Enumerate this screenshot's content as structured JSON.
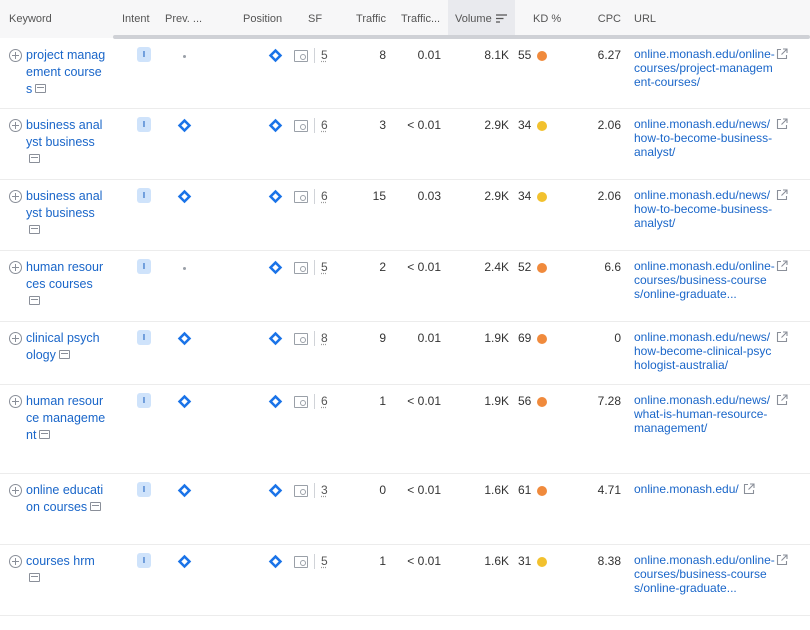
{
  "header": {
    "keyword": "Keyword",
    "intent": "Intent",
    "prev": "Prev. ...",
    "position": "Position",
    "sf": "SF",
    "traffic": "Traffic",
    "traffic_share": "Traffic...",
    "volume": "Volume",
    "kd": "KD %",
    "cpc": "CPC",
    "url": "URL"
  },
  "colors": {
    "link": "#1a66c9",
    "kd_orange": "#f08a3c",
    "kd_yellow": "#f2c12e",
    "intent_bg": "#cfe3fb",
    "diamond": "#1a73e8"
  },
  "rows": [
    {
      "keyword": "project management courses",
      "intent": "I",
      "prev": "dot",
      "sf": "5",
      "traffic": "8",
      "traffic_share": "0.01",
      "volume": "8.1K",
      "kd": "55",
      "kd_color": "orange",
      "cpc": "6.27",
      "url": "online.monash.edu/online-courses/project-management-courses/"
    },
    {
      "keyword": "business analyst business",
      "intent": "I",
      "prev": "diamond",
      "sf": "6",
      "traffic": "3",
      "traffic_share": "< 0.01",
      "volume": "2.9K",
      "kd": "34",
      "kd_color": "yellow",
      "cpc": "2.06",
      "url": "online.monash.edu/news/how-to-become-business-analyst/"
    },
    {
      "keyword": "business analyst business",
      "intent": "I",
      "prev": "diamond",
      "sf": "6",
      "traffic": "15",
      "traffic_share": "0.03",
      "volume": "2.9K",
      "kd": "34",
      "kd_color": "yellow",
      "cpc": "2.06",
      "url": "online.monash.edu/news/how-to-become-business-analyst/"
    },
    {
      "keyword": "human resources courses",
      "intent": "I",
      "prev": "dot",
      "sf": "5",
      "traffic": "2",
      "traffic_share": "< 0.01",
      "volume": "2.4K",
      "kd": "52",
      "kd_color": "orange",
      "cpc": "6.6",
      "url": "online.monash.edu/online-courses/business-courses/online-graduate..."
    },
    {
      "keyword": "clinical psychology",
      "intent": "I",
      "prev": "diamond",
      "sf": "8",
      "traffic": "9",
      "traffic_share": "0.01",
      "volume": "1.9K",
      "kd": "69",
      "kd_color": "orange",
      "cpc": "0",
      "url": "online.monash.edu/news/how-become-clinical-psychologist-australia/"
    },
    {
      "keyword": "human resource management",
      "intent": "I",
      "prev": "diamond",
      "sf": "6",
      "traffic": "1",
      "traffic_share": "< 0.01",
      "volume": "1.9K",
      "kd": "56",
      "kd_color": "orange",
      "cpc": "7.28",
      "url": "online.monash.edu/news/what-is-human-resource-management/"
    },
    {
      "keyword": "online education courses",
      "intent": "I",
      "prev": "diamond",
      "sf": "3",
      "traffic": "0",
      "traffic_share": "< 0.01",
      "volume": "1.6K",
      "kd": "61",
      "kd_color": "orange",
      "cpc": "4.71",
      "url": "online.monash.edu/"
    },
    {
      "keyword": "courses hrm",
      "intent": "I",
      "prev": "diamond",
      "sf": "5",
      "traffic": "1",
      "traffic_share": "< 0.01",
      "volume": "1.6K",
      "kd": "31",
      "kd_color": "yellow",
      "cpc": "8.38",
      "url": "online.monash.edu/online-courses/business-courses/online-graduate..."
    }
  ]
}
